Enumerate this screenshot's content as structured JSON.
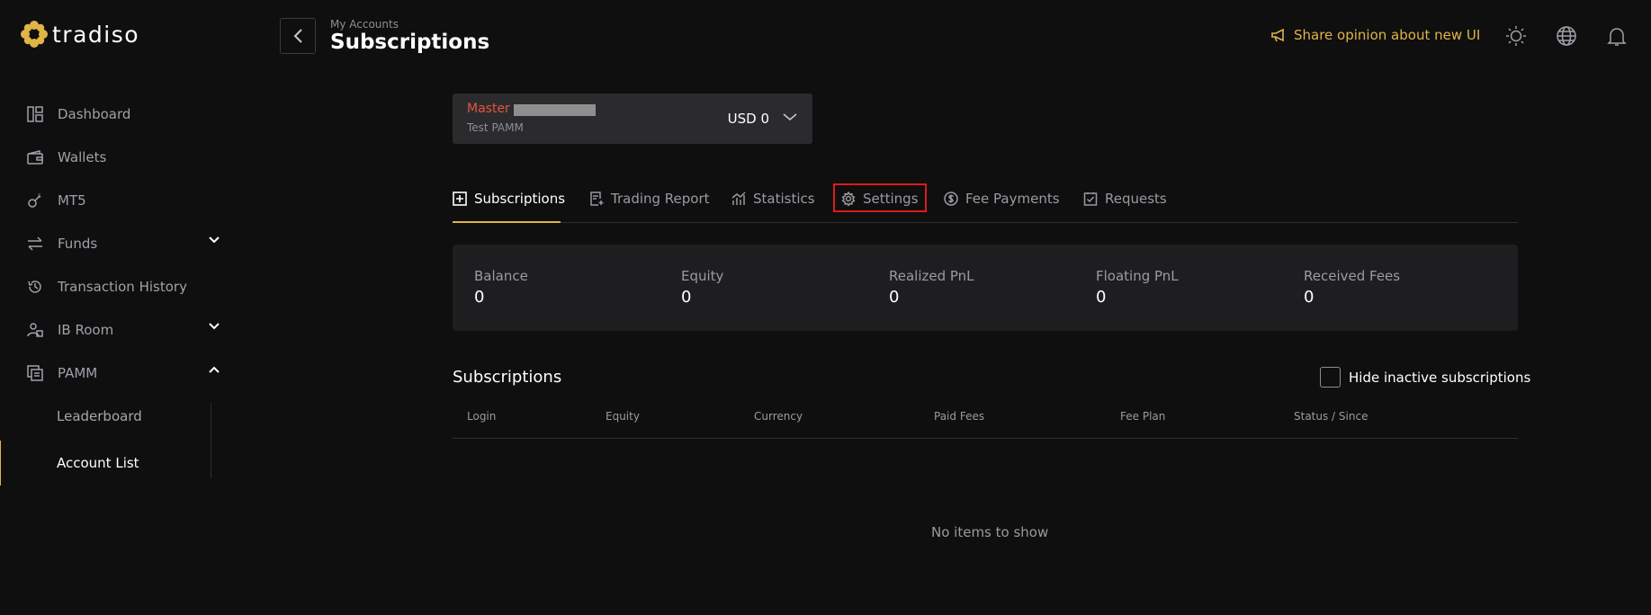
{
  "brand": {
    "name": "tradiso",
    "accent": "#e0b547"
  },
  "sidebar": {
    "items": [
      {
        "label": "Dashboard",
        "icon": "dashboard-icon"
      },
      {
        "label": "Wallets",
        "icon": "wallet-icon"
      },
      {
        "label": "MT5",
        "icon": "mt5-icon"
      },
      {
        "label": "Funds",
        "icon": "transfer-icon"
      },
      {
        "label": "Transaction History",
        "icon": "history-icon"
      },
      {
        "label": "IB Room",
        "icon": "ib-room-icon"
      },
      {
        "label": "PAMM",
        "icon": "pamm-icon"
      }
    ],
    "pamm_sub": [
      {
        "label": "Leaderboard"
      },
      {
        "label": "Account List"
      }
    ]
  },
  "header": {
    "breadcrumb": "My Accounts",
    "title": "Subscriptions",
    "share_label": "Share opinion about new UI"
  },
  "account": {
    "name": "Master",
    "type": "Test PAMM",
    "balance": "USD 0"
  },
  "tabs": [
    {
      "label": "Subscriptions",
      "icon": "plus-square-icon",
      "active": true
    },
    {
      "label": "Trading Report",
      "icon": "report-icon"
    },
    {
      "label": "Statistics",
      "icon": "statistics-icon"
    },
    {
      "label": "Settings",
      "icon": "gear-icon",
      "highlighted": true
    },
    {
      "label": "Fee Payments",
      "icon": "dollar-circle-icon"
    },
    {
      "label": "Requests",
      "icon": "check-square-icon"
    }
  ],
  "stats": [
    {
      "label": "Balance",
      "value": "0"
    },
    {
      "label": "Equity",
      "value": "0"
    },
    {
      "label": "Realized PnL",
      "value": "0"
    },
    {
      "label": "Floating PnL",
      "value": "0"
    },
    {
      "label": "Received Fees",
      "value": "0"
    }
  ],
  "subscriptions": {
    "title": "Subscriptions",
    "hide_inactive_label": "Hide inactive subscriptions",
    "columns": [
      "Login",
      "Equity",
      "Currency",
      "Paid Fees",
      "Fee Plan",
      "Status / Since"
    ],
    "empty_text": "No items to show"
  }
}
